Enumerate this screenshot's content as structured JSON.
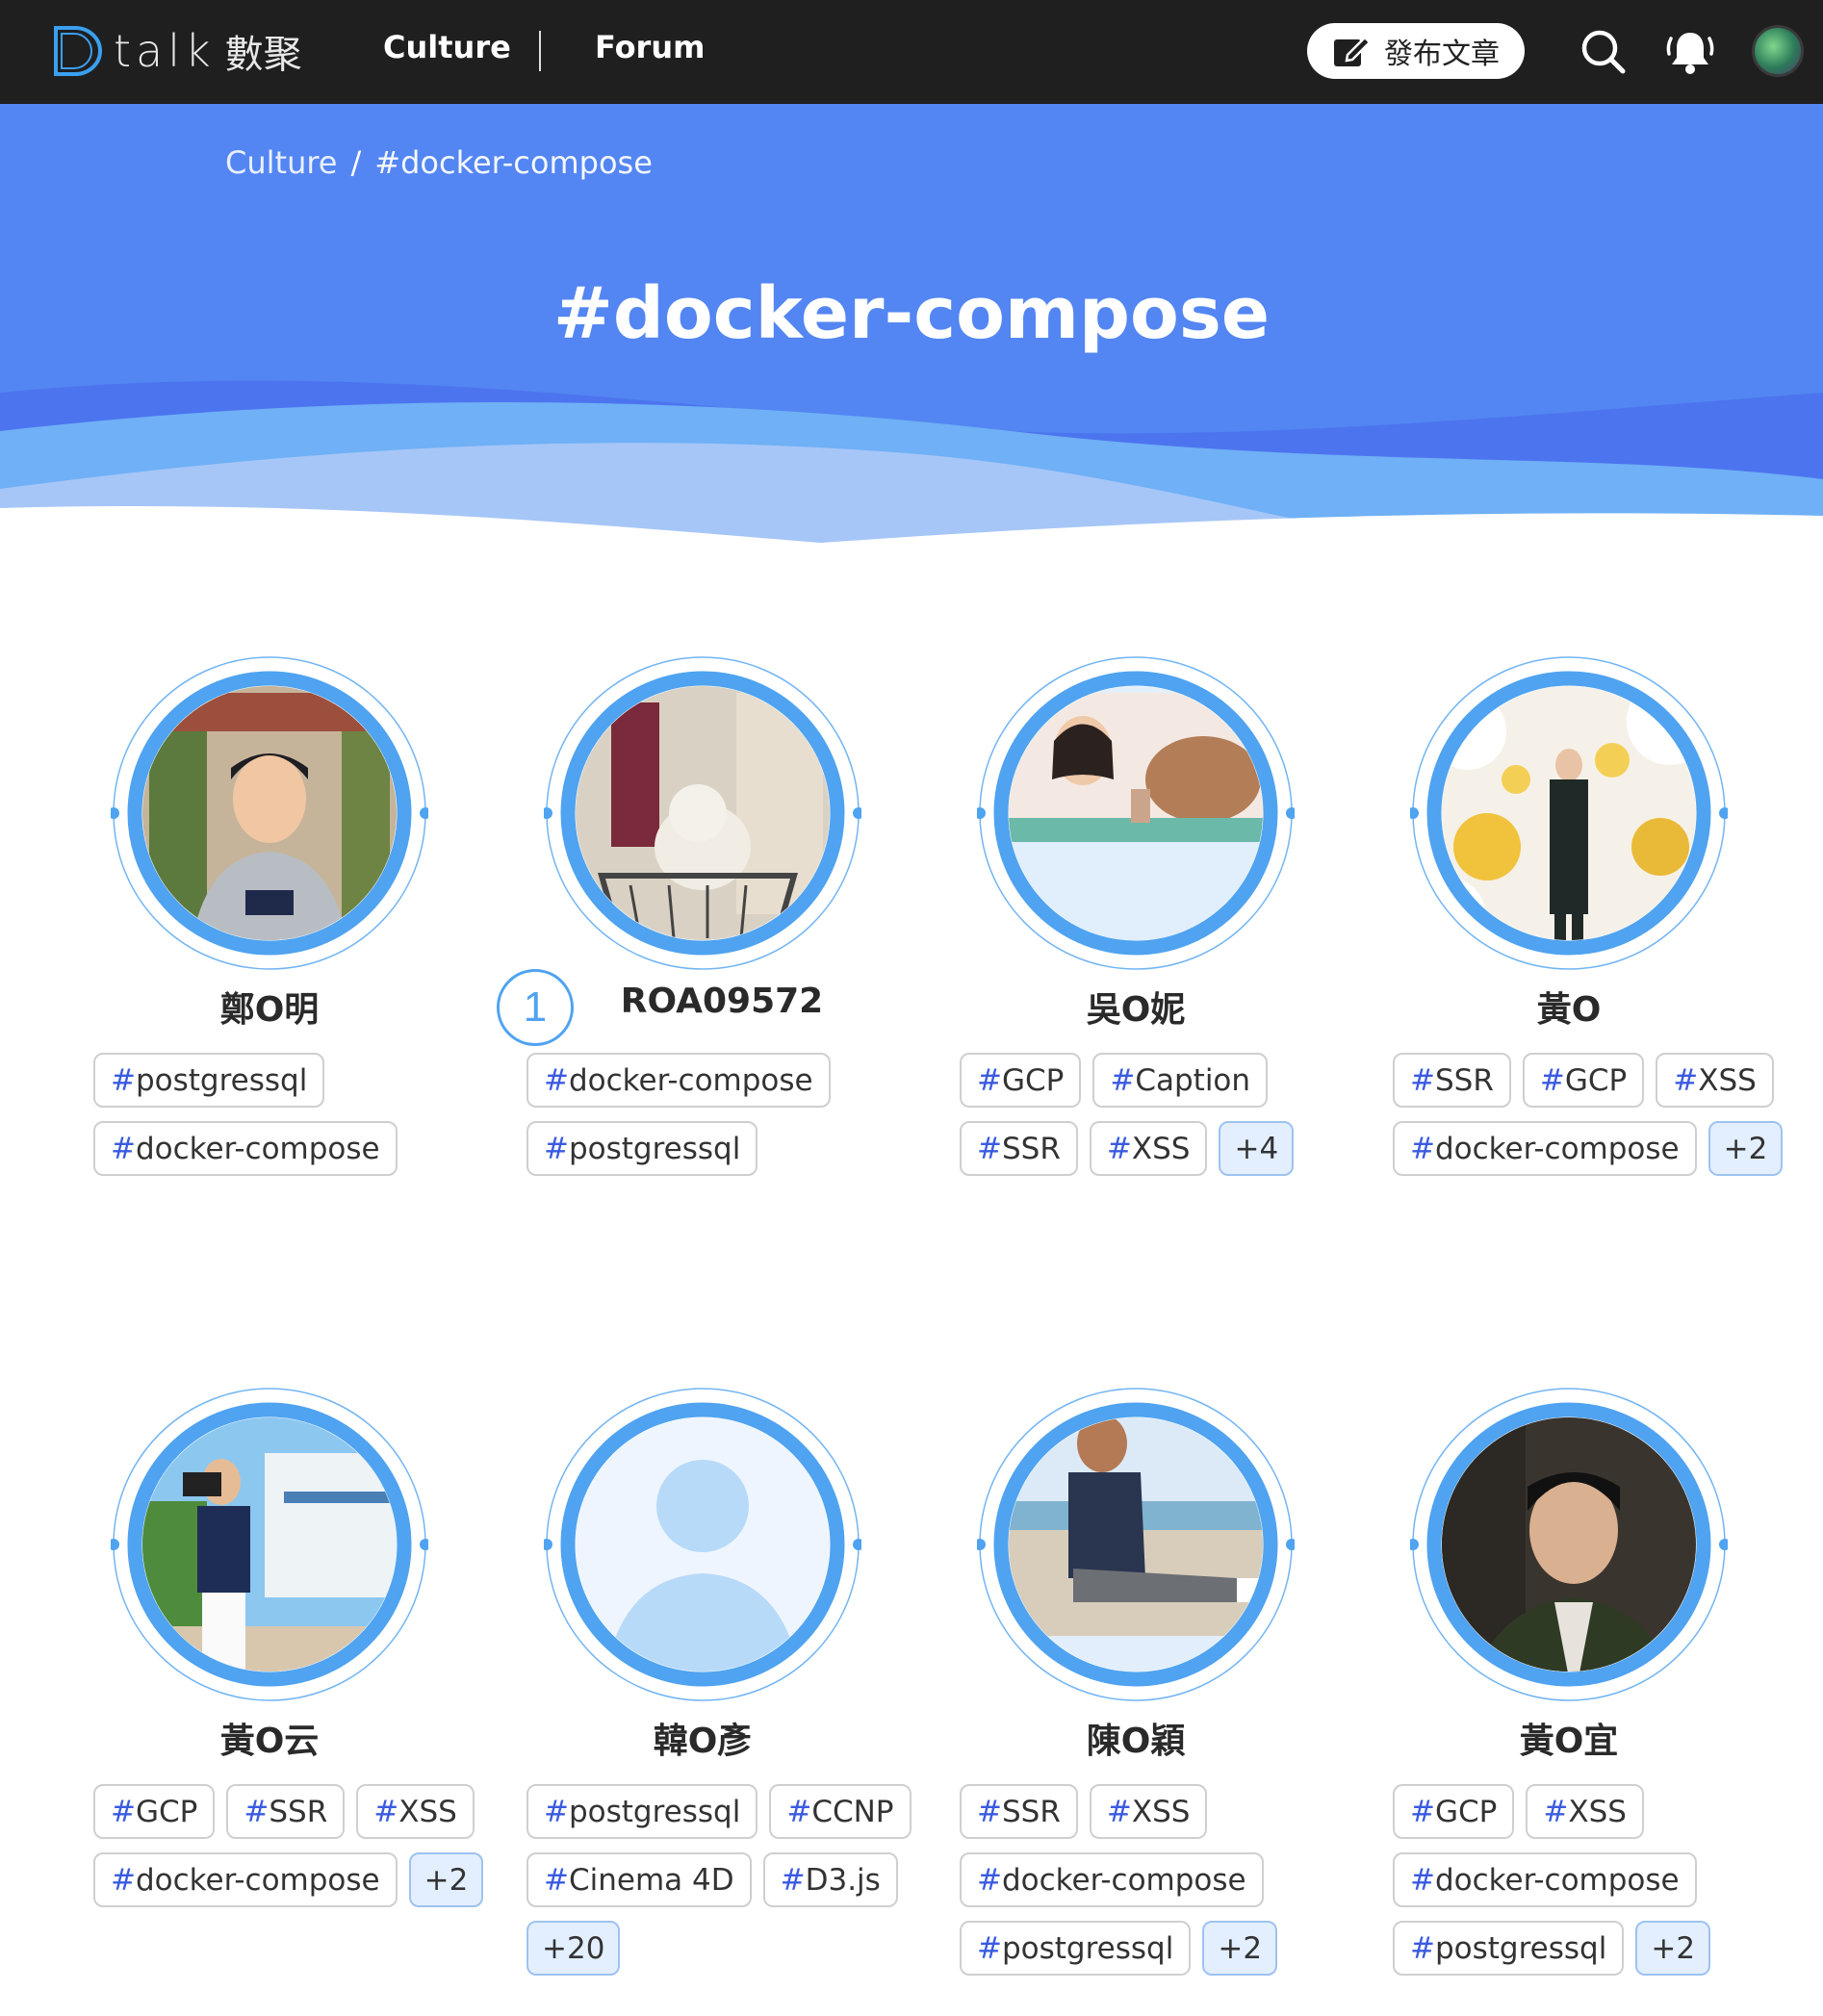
{
  "nav": {
    "logo_text": "talk",
    "logo_cn": "數聚",
    "links": [
      "Culture",
      "Forum"
    ],
    "publish_label": "發布文章"
  },
  "breadcrumb": {
    "parent": "Culture",
    "separator": "/",
    "current": "#docker-compose"
  },
  "hero": {
    "title": "#docker-compose"
  },
  "colors": {
    "hero_bg": "#5386f2",
    "ring": "#4fa3f0",
    "tag_hash": "#3a5be0",
    "nav_bg": "#1f1f1f"
  },
  "cards": [
    {
      "name": "鄭O明",
      "photo": "portrait-hoodie",
      "tags": [
        "postgressql",
        "docker-compose"
      ],
      "more": ""
    },
    {
      "name": "ROA09572",
      "photo": "dog-in-cart",
      "rank": "1",
      "tags": [
        "docker-compose",
        "postgressql"
      ],
      "more": ""
    },
    {
      "name": "吳O妮",
      "photo": "cafe-capybara",
      "tags": [
        "GCP",
        "Caption",
        "SSR",
        "XSS"
      ],
      "more": "+4"
    },
    {
      "name": "黃O",
      "photo": "balloon-wall",
      "tags": [
        "SSR",
        "GCP",
        "XSS",
        "docker-compose"
      ],
      "more": "+2"
    },
    {
      "name": "黃O云",
      "photo": "photographer-resort",
      "tags": [
        "GCP",
        "SSR",
        "XSS",
        "docker-compose"
      ],
      "more": "+2"
    },
    {
      "name": "韓O彥",
      "photo": "default-avatar",
      "tags": [
        "postgressql",
        "CCNP",
        "Cinema 4D",
        "D3.js"
      ],
      "more": "+20"
    },
    {
      "name": "陳O穎",
      "photo": "beach-sitting",
      "tags": [
        "SSR",
        "XSS",
        "docker-compose",
        "postgressql"
      ],
      "more": "+2"
    },
    {
      "name": "黃O宜",
      "photo": "dark-portrait",
      "tags": [
        "GCP",
        "XSS",
        "docker-compose",
        "postgressql"
      ],
      "more": "+2"
    }
  ]
}
